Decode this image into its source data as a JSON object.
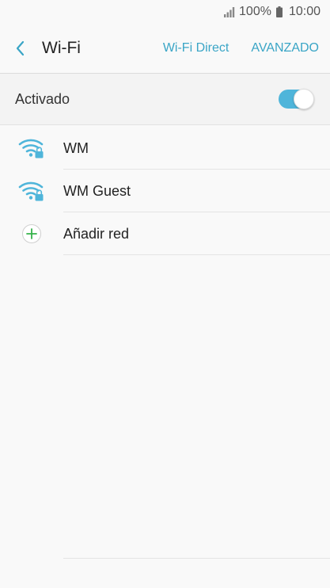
{
  "status_bar": {
    "battery_text": "100%",
    "time": "10:00"
  },
  "header": {
    "title": "Wi-Fi",
    "actions": [
      {
        "label": "Wi-Fi Direct"
      },
      {
        "label": "AVANZADO"
      }
    ]
  },
  "master_switch": {
    "label": "Activado",
    "state": "on"
  },
  "networks": [
    {
      "name": "WM",
      "icon": "wifi-locked-icon"
    },
    {
      "name": "WM Guest",
      "icon": "wifi-locked-icon"
    }
  ],
  "add_network": {
    "label": "Añadir red",
    "icon": "plus-icon"
  },
  "colors": {
    "accent": "#3aa5c6",
    "toggle_on": "#4fb5da",
    "add_icon": "#35b24a"
  }
}
